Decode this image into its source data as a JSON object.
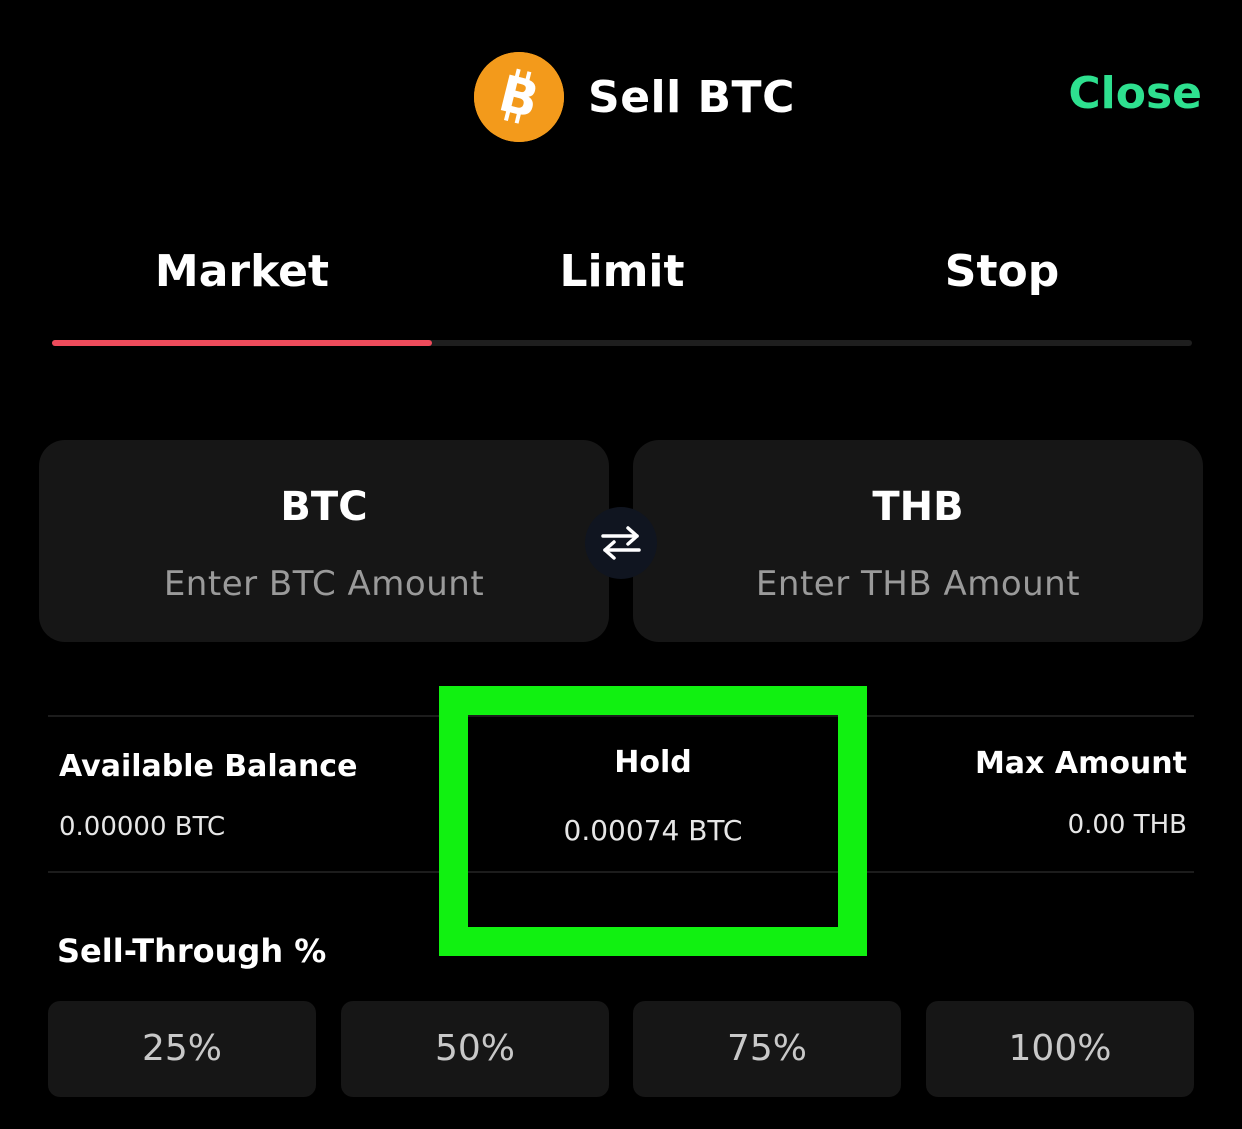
{
  "header": {
    "title": "Sell BTC",
    "close_label": "Close",
    "logo_icon": "bitcoin-logo-icon"
  },
  "tabs": [
    {
      "label": "Market",
      "active": true
    },
    {
      "label": "Limit",
      "active": false
    },
    {
      "label": "Stop",
      "active": false
    }
  ],
  "amount_inputs": {
    "left": {
      "currency": "BTC",
      "placeholder": "Enter BTC Amount"
    },
    "right": {
      "currency": "THB",
      "placeholder": "Enter THB Amount"
    },
    "swap_icon": "swap-arrows-icon"
  },
  "balances": {
    "available": {
      "label": "Available Balance",
      "value": "0.00000 BTC"
    },
    "hold": {
      "label": "Hold",
      "value": "0.00074 BTC"
    },
    "max": {
      "label": "Max Amount",
      "value": "0.00 THB"
    }
  },
  "sell_through": {
    "label": "Sell-Through %",
    "options": [
      "25%",
      "50%",
      "75%",
      "100%"
    ]
  },
  "colors": {
    "background": "#000000",
    "accent_close": "#2ee08f",
    "tab_indicator": "#ee4b5b",
    "highlight": "#11f111",
    "btc_orange": "#f39a1b"
  }
}
